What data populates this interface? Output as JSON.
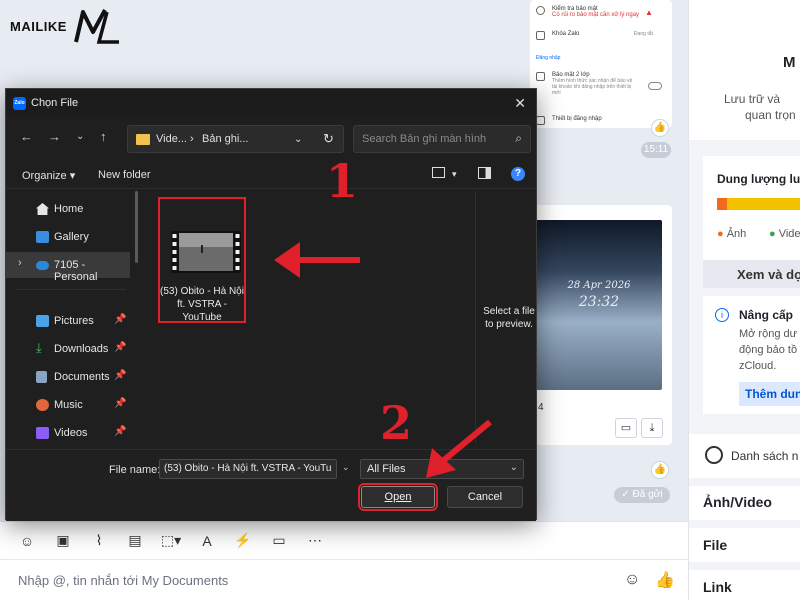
{
  "logo": {
    "text": "MAILIKE",
    "mark": "ML"
  },
  "phone_card": {
    "security_check": "Kiểm tra bảo mật",
    "security_risk": "Có rủi ro bảo mật cần xử lý ngay",
    "zalo_lock": "Khóa Zalo",
    "zalo_lock_status": "Đang tắt",
    "login_section": "Đăng nhập",
    "two_factor": "Bảo mật 2 lớp",
    "two_factor_desc": "Thêm hình thức xác nhận để bảo vệ tài khoản khi đăng nhập trên thiết bị mới",
    "login_devices": "Thiết bị đăng nhập"
  },
  "chat": {
    "time_pill": "15:11",
    "video_date": "28 Apr 2026",
    "video_time": "23:32",
    "video_side_number": "4",
    "sent_status": "✓ Đã gửi",
    "composer_placeholder": "Nhập @, tin nhắn tới My Documents"
  },
  "right_panel": {
    "letter_m": "M",
    "storage_desc_1": "Lưu trữ và",
    "storage_desc_2": "quan trọn",
    "storage_title": "Dung lượng lu",
    "legend_photo": "Ảnh",
    "legend_video": "Vide",
    "view_button": "Xem và dọ",
    "upgrade_title": "Nâng cấp",
    "upgrade_desc_1": "Mở rộng dư",
    "upgrade_desc_2": "động bảo tồ",
    "upgrade_desc_3": "zCloud.",
    "add_button": "Thêm dun",
    "reminder": "Danh sách n",
    "section_media": "Ảnh/Video",
    "section_file": "File",
    "section_link": "Link"
  },
  "dialog": {
    "title": "Chọn File",
    "breadcrumb": [
      "Vide...",
      "›",
      "Bản ghi..."
    ],
    "search_placeholder": "Search Bản ghi màn hình",
    "organize": "Organize ▾",
    "new_folder": "New folder",
    "nav_items": [
      {
        "label": "Home",
        "icon": "home-icon"
      },
      {
        "label": "Gallery",
        "icon": "gallery-icon"
      },
      {
        "label": "7105 - Personal",
        "icon": "cloud-icon"
      },
      {
        "label": "Pictures",
        "icon": "pictures-icon"
      },
      {
        "label": "Downloads",
        "icon": "download-icon"
      },
      {
        "label": "Documents",
        "icon": "documents-icon"
      },
      {
        "label": "Music",
        "icon": "music-icon"
      },
      {
        "label": "Videos",
        "icon": "videos-icon"
      }
    ],
    "file": {
      "name": "(53) Obito - Hà Nội ft. VSTRA - YouTube"
    },
    "preview_text": "Select a file to preview.",
    "file_name_label": "File name:",
    "file_name_value": "(53) Obito - Hà Nội ft. VSTRA - YouTu",
    "file_type": "All Files",
    "open_button": "Open",
    "cancel_button": "Cancel"
  },
  "annotations": {
    "step1": "1",
    "step2": "2"
  },
  "colors": {
    "accent_red": "#e0202a",
    "zalo_blue": "#0068ff",
    "dialog_bg": "#1f1f1f"
  }
}
